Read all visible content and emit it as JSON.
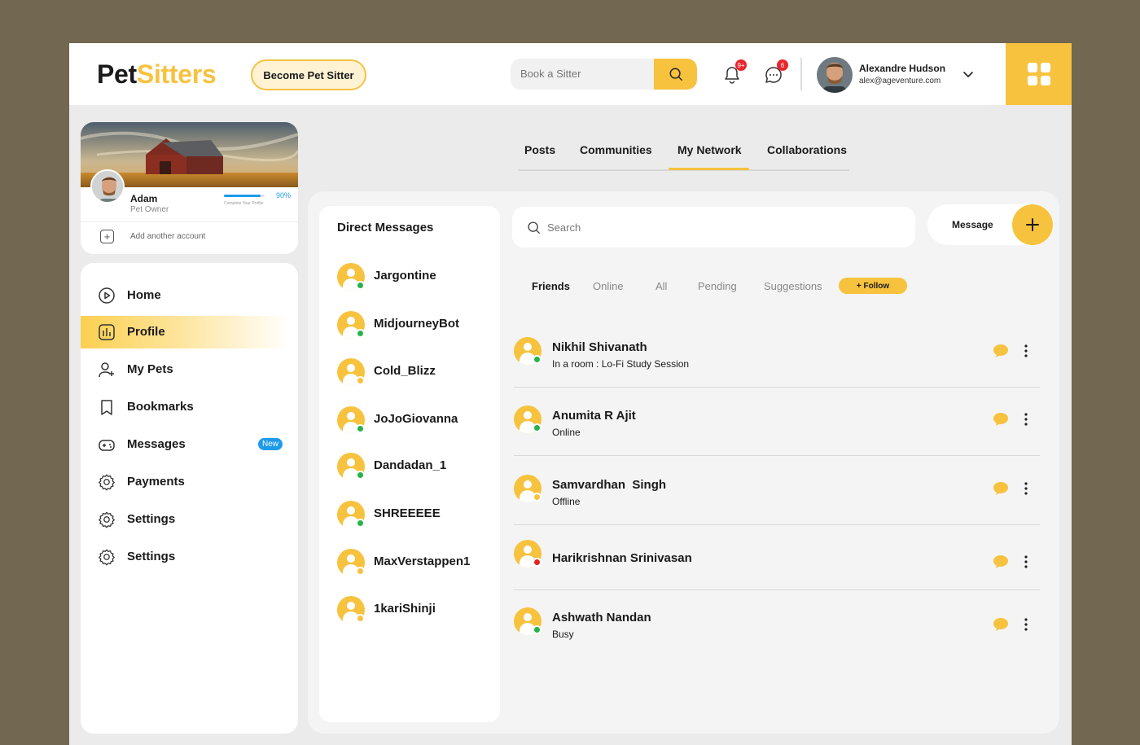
{
  "brand": {
    "part1": "Pet",
    "part2": "Sitters"
  },
  "header": {
    "become_label": "Become Pet Sitter",
    "search_placeholder": "Book a Sitter",
    "notifications_count": "9+",
    "messages_count": "6",
    "user_name": "Alexandre Hudson",
    "user_email": "alex@ageventure.com"
  },
  "profile_card": {
    "name": "Adam",
    "role": "Pet Owner",
    "progress_percent": 90,
    "progress_label": "90%",
    "progress_caption": "Complete Your Profile",
    "add_account": "Add another account"
  },
  "sidebar": {
    "items": [
      {
        "label": "Home",
        "icon": "play-circle-icon"
      },
      {
        "label": "Profile",
        "icon": "chart-bars-icon",
        "active": true
      },
      {
        "label": "My Pets",
        "icon": "user-add-icon"
      },
      {
        "label": "Bookmarks",
        "icon": "bookmark-icon"
      },
      {
        "label": "Messages",
        "icon": "gamepad-icon",
        "badge": "New"
      },
      {
        "label": "Payments",
        "icon": "gear-icon"
      },
      {
        "label": "Settings",
        "icon": "gear-icon"
      },
      {
        "label": "Settings",
        "icon": "gear-icon"
      }
    ]
  },
  "tabs": [
    "Posts",
    "Communities",
    "My Network",
    "Collaborations"
  ],
  "active_tab": "My Network",
  "direct_messages": {
    "title": "Direct Messages",
    "users": [
      {
        "name": "Jargontine",
        "status": "green"
      },
      {
        "name": "MidjourneyBot",
        "status": "green"
      },
      {
        "name": "Cold_Blizz",
        "status": "yellow"
      },
      {
        "name": "JoJoGiovanna",
        "status": "green"
      },
      {
        "name": "Dandadan_1",
        "status": "green"
      },
      {
        "name": "SHREEEEE",
        "status": "green"
      },
      {
        "name": "MaxVerstappen1",
        "status": "yellow"
      },
      {
        "name": "1kariShinji",
        "status": "yellow"
      }
    ]
  },
  "network": {
    "search_placeholder": "Search",
    "message_label": "Message",
    "filters": [
      "Friends",
      "Online",
      "All",
      "Pending",
      "Suggestions"
    ],
    "active_filter": "Friends",
    "follow_label": "+ Follow",
    "friends": [
      {
        "name": "Nikhil Shivanath",
        "status_text": "In a room : Lo-Fi Study Session",
        "status": "green"
      },
      {
        "name": "Anumita R Ajit",
        "status_text": "Online",
        "status": "green"
      },
      {
        "name": "Samvardhan  Singh",
        "status_text": "Offline",
        "status": "yellow"
      },
      {
        "name": "Harikrishnan Srinivasan",
        "status_text": "",
        "status": "red"
      },
      {
        "name": "Ashwath Nandan",
        "status_text": "Busy",
        "status": "green"
      }
    ]
  },
  "colors": {
    "accent": "#f7c23e",
    "frame": "#726750",
    "online": "#26b34a",
    "busy": "#e0241b",
    "link": "#1e9be9"
  }
}
